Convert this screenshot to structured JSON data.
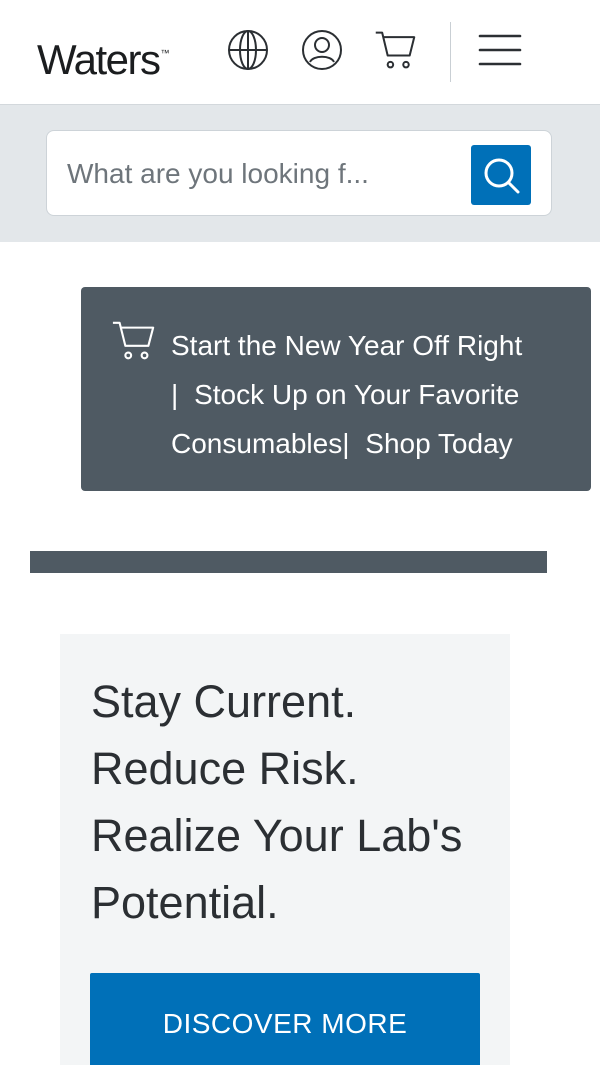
{
  "header": {
    "logo_text": "Waters",
    "logo_tm": "™",
    "icons": [
      "globe-icon",
      "user-icon",
      "cart-icon",
      "menu-icon"
    ]
  },
  "search": {
    "placeholder": "What are you looking f..."
  },
  "promo": {
    "icon": "cart-icon",
    "line1": "Start the New Year Off Right",
    "sep1": "|",
    "line2": "Stock Up on Your Favorite",
    "line3": "Consumables",
    "sep2": "|",
    "link": "Shop Today"
  },
  "hero": {
    "title_lines": [
      "Stay Current.",
      "Reduce Risk.",
      "Realize Your Lab's",
      "Potential."
    ],
    "cta_label": "DISCOVER MORE"
  },
  "colors": {
    "brand_blue": "#0070b8",
    "slate": "#4f5a63",
    "search_band": "#e3e7ea",
    "hero_bg": "#f3f5f6"
  }
}
